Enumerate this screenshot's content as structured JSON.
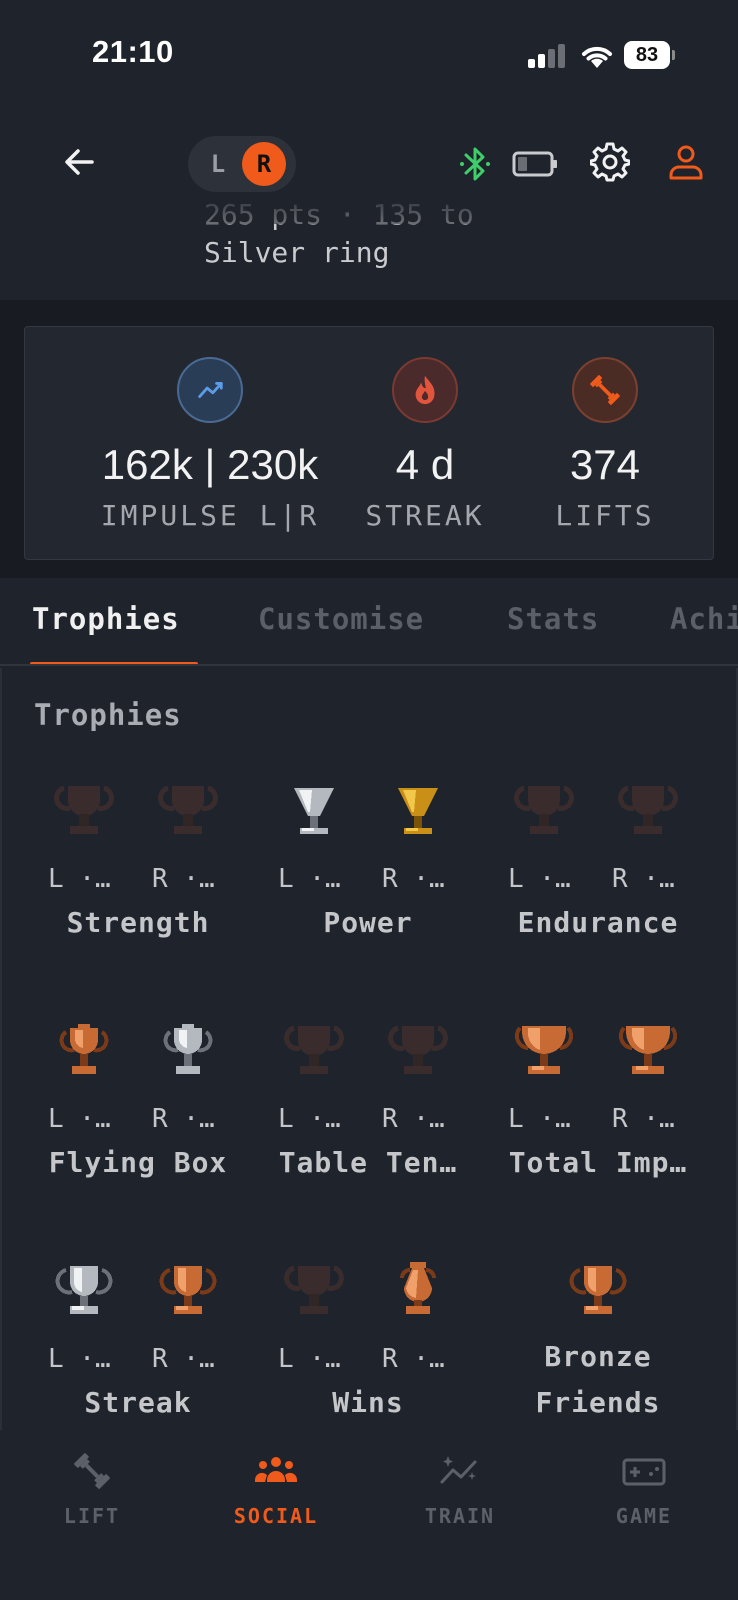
{
  "status_bar": {
    "time": "21:10",
    "battery_level": "83"
  },
  "header": {
    "side_toggle": {
      "left": "L",
      "right": "R",
      "selected": "R"
    },
    "rank_line1": "265 pts · 135 to",
    "rank_line2": "Silver ring",
    "icons": [
      "back-arrow-icon",
      "bluetooth-icon",
      "device-battery-icon",
      "gear-icon",
      "user-icon"
    ]
  },
  "stats": [
    {
      "icon": "trend-icon",
      "value": "162k | 230k",
      "label": "IMPULSE L|R"
    },
    {
      "icon": "flame-icon",
      "value": "4 d",
      "label": "STREAK"
    },
    {
      "icon": "dumbbell-icon",
      "value": "374",
      "label": "LIFTS"
    }
  ],
  "tabs": [
    "Trophies",
    "Customise",
    "Stats",
    "Achievements"
  ],
  "active_tab": "Trophies",
  "trophies": {
    "title": "Trophies",
    "items": [
      {
        "name": "Strength",
        "l": "L ·…",
        "r": "R ·…",
        "l_trophy": "locked",
        "r_trophy": "locked"
      },
      {
        "name": "Power",
        "l": "L ·…",
        "r": "R ·…",
        "l_trophy": "silver",
        "r_trophy": "gold"
      },
      {
        "name": "Endurance",
        "l": "L ·…",
        "r": "R ·…",
        "l_trophy": "locked",
        "r_trophy": "locked"
      },
      {
        "name": "Flying Box",
        "l": "L ·…",
        "r": "R ·…",
        "l_trophy": "bronze",
        "r_trophy": "silver"
      },
      {
        "name": "Table Ten…",
        "l": "L ·…",
        "r": "R ·…",
        "l_trophy": "locked",
        "r_trophy": "locked"
      },
      {
        "name": "Total Imp…",
        "l": "L ·…",
        "r": "R ·…",
        "l_trophy": "bronze",
        "r_trophy": "bronze"
      },
      {
        "name": "Streak",
        "l": "L ·…",
        "r": "R ·…",
        "l_trophy": "silver",
        "r_trophy": "bronze"
      },
      {
        "name": "Wins",
        "l": "L ·…",
        "r": "R ·…",
        "l_trophy": "locked",
        "r_trophy": "bronze"
      },
      {
        "name_line1": "Bronze",
        "name_line2": "Friends",
        "trophy": "bronze"
      }
    ]
  },
  "bottom_nav": [
    {
      "label": "LIFT",
      "icon": "dumbbell-icon"
    },
    {
      "label": "SOCIAL",
      "icon": "people-icon",
      "active": true
    },
    {
      "label": "TRAIN",
      "icon": "trend-sparkle-icon"
    },
    {
      "label": "GAME",
      "icon": "gamepad-icon"
    }
  ],
  "colors": {
    "accent": "#f05a1a",
    "background": "#1f232b",
    "bluetooth": "#3ecf6a",
    "gold": "#d9a520",
    "silver": "#c8cbd0",
    "bronze": "#cf7a40"
  }
}
